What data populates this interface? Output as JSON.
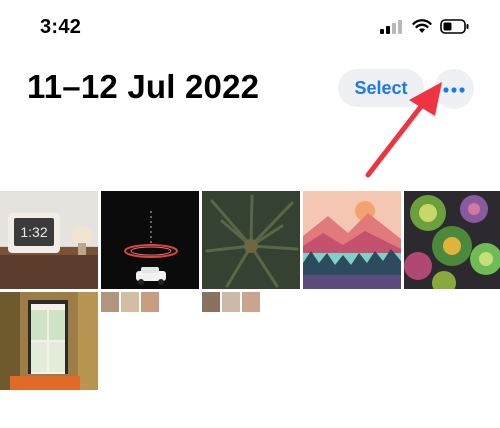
{
  "status_bar": {
    "time": "3:42",
    "icons": [
      "signal-icon",
      "wifi-icon",
      "battery-icon"
    ]
  },
  "header": {
    "title": "11–12 Jul 2022",
    "select_label": "Select",
    "more_icon": "ellipsis-icon"
  },
  "annotation": {
    "type": "arrow",
    "color": "#ef3340"
  },
  "colors": {
    "accent": "#1a78f2",
    "button_bg": "#eef0f3"
  },
  "photos": {
    "row1": [
      {
        "name": "clock-display",
        "clock_text": "1:32"
      },
      {
        "name": "car-light-trail"
      },
      {
        "name": "palm-tree"
      },
      {
        "name": "mountain-lake-illustration"
      },
      {
        "name": "succulents"
      }
    ],
    "row2": [
      {
        "name": "window-doorway"
      },
      {
        "name": "tiny-thumbnail-strip"
      },
      {
        "name": "tiny-thumbnail-strip"
      }
    ]
  }
}
